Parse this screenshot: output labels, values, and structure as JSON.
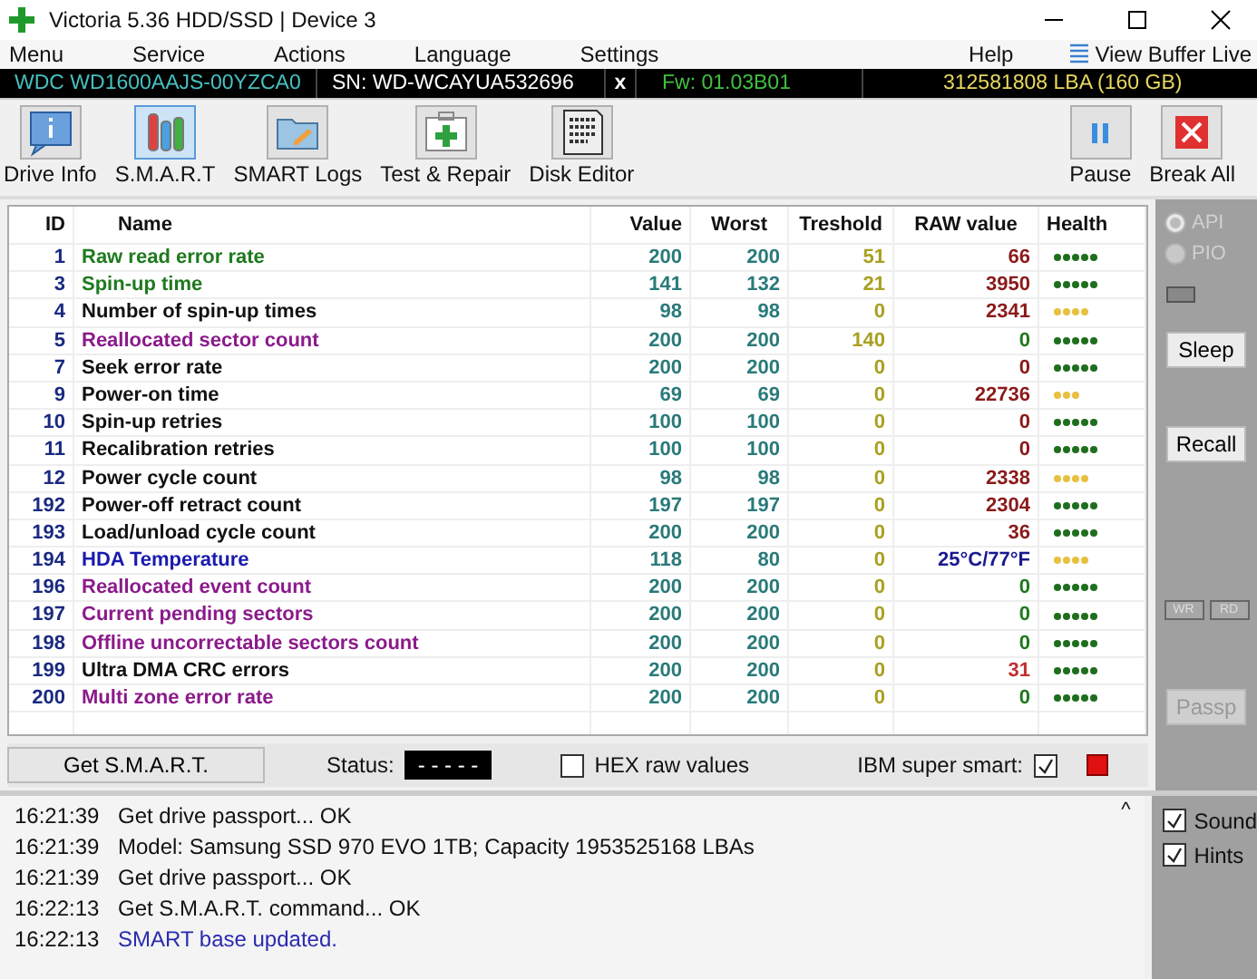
{
  "window": {
    "title": "Victoria 5.36 HDD/SSD | Device 3"
  },
  "menu": [
    "Menu",
    "Service",
    "Actions",
    "Language",
    "Settings",
    "Help"
  ],
  "view_buffer": "View Buffer Live",
  "drive_bar": {
    "model": "WDC WD1600AAJS-00YZCA0",
    "serial": "SN: WD-WCAYUA532696",
    "close": "x",
    "firmware": "Fw: 01.03B01",
    "capacity": "312581808 LBA (160 GB)"
  },
  "toolbar": [
    {
      "label": "Drive Info",
      "kind": "info",
      "selected": false
    },
    {
      "label": "S.M.A.R.T",
      "kind": "smart",
      "selected": true
    },
    {
      "label": "SMART Logs",
      "kind": "logs",
      "selected": false
    },
    {
      "label": "Test & Repair",
      "kind": "repair",
      "selected": false
    },
    {
      "label": "Disk Editor",
      "kind": "editor",
      "selected": false
    }
  ],
  "toolbar_right": [
    {
      "label": "Pause",
      "kind": "pause"
    },
    {
      "label": "Break All",
      "kind": "break"
    }
  ],
  "table": {
    "columns": [
      "ID",
      "Name",
      "Value",
      "Worst",
      "Treshold",
      "RAW value",
      "Health"
    ],
    "rows": [
      {
        "id": "1",
        "name": "Raw read error rate",
        "value": "200",
        "worst": "200",
        "treshold": "51",
        "raw": {
          "text": "66",
          "kind": "count"
        },
        "stars": 5,
        "color": "#1e7a1e"
      },
      {
        "id": "3",
        "name": "Spin-up time",
        "value": "141",
        "worst": "132",
        "treshold": "21",
        "raw": {
          "text": "3950",
          "kind": "count"
        },
        "stars": 5,
        "color": "#1e7a1e"
      },
      {
        "id": "4",
        "name": "Number of spin-up times",
        "value": "98",
        "worst": "98",
        "treshold": "0",
        "raw": {
          "text": "2341",
          "kind": "count"
        },
        "stars": 4,
        "color": "#111111"
      },
      {
        "id": "5",
        "name": "Reallocated sector count",
        "value": "200",
        "worst": "200",
        "treshold": "140",
        "raw": {
          "text": "0",
          "kind": "good"
        },
        "stars": 5,
        "color": "#8b1a8b"
      },
      {
        "id": "7",
        "name": "Seek error rate",
        "value": "200",
        "worst": "200",
        "treshold": "0",
        "raw": {
          "text": "0",
          "kind": "count"
        },
        "stars": 5,
        "color": "#111111"
      },
      {
        "id": "9",
        "name": "Power-on time",
        "value": "69",
        "worst": "69",
        "treshold": "0",
        "raw": {
          "text": "22736",
          "kind": "count"
        },
        "stars": 3,
        "color": "#111111"
      },
      {
        "id": "10",
        "name": "Spin-up retries",
        "value": "100",
        "worst": "100",
        "treshold": "0",
        "raw": {
          "text": "0",
          "kind": "count"
        },
        "stars": 5,
        "color": "#111111"
      },
      {
        "id": "11",
        "name": "Recalibration retries",
        "value": "100",
        "worst": "100",
        "treshold": "0",
        "raw": {
          "text": "0",
          "kind": "count"
        },
        "stars": 5,
        "color": "#111111"
      },
      {
        "id": "12",
        "name": "Power cycle count",
        "value": "98",
        "worst": "98",
        "treshold": "0",
        "raw": {
          "text": "2338",
          "kind": "count"
        },
        "stars": 4,
        "color": "#111111"
      },
      {
        "id": "192",
        "name": "Power-off retract count",
        "value": "197",
        "worst": "197",
        "treshold": "0",
        "raw": {
          "text": "2304",
          "kind": "count"
        },
        "stars": 5,
        "color": "#111111"
      },
      {
        "id": "193",
        "name": "Load/unload cycle count",
        "value": "200",
        "worst": "200",
        "treshold": "0",
        "raw": {
          "text": "36",
          "kind": "count"
        },
        "stars": 5,
        "color": "#111111"
      },
      {
        "id": "194",
        "name": "HDA Temperature",
        "value": "118",
        "worst": "80",
        "treshold": "0",
        "raw": {
          "text": "25°C/77°F",
          "kind": "temperature"
        },
        "stars": 4,
        "color": "#1a1ab0"
      },
      {
        "id": "196",
        "name": "Reallocated event count",
        "value": "200",
        "worst": "200",
        "treshold": "0",
        "raw": {
          "text": "0",
          "kind": "good"
        },
        "stars": 5,
        "color": "#8b1a8b"
      },
      {
        "id": "197",
        "name": "Current pending sectors",
        "value": "200",
        "worst": "200",
        "treshold": "0",
        "raw": {
          "text": "0",
          "kind": "good"
        },
        "stars": 5,
        "color": "#8b1a8b"
      },
      {
        "id": "198",
        "name": "Offline uncorrectable sectors count",
        "value": "200",
        "worst": "200",
        "treshold": "0",
        "raw": {
          "text": "0",
          "kind": "good"
        },
        "stars": 5,
        "color": "#8b1a8b"
      },
      {
        "id": "199",
        "name": "Ultra DMA CRC errors",
        "value": "200",
        "worst": "200",
        "treshold": "0",
        "raw": {
          "text": "31",
          "kind": "error"
        },
        "stars": 5,
        "color": "#111111"
      },
      {
        "id": "200",
        "name": "Multi zone error rate",
        "value": "200",
        "worst": "200",
        "treshold": "0",
        "raw": {
          "text": "0",
          "kind": "good"
        },
        "stars": 5,
        "color": "#8b1a8b"
      }
    ]
  },
  "side_panel": {
    "radios": [
      {
        "label": "API",
        "selected": true,
        "disabled": true
      },
      {
        "label": "PIO",
        "selected": false,
        "disabled": true
      }
    ],
    "buttons": [
      {
        "label": "Sleep",
        "disabled": false
      },
      {
        "label": "Recall",
        "disabled": false
      }
    ],
    "small_buttons": [
      {
        "label": "WR",
        "disabled": true
      },
      {
        "label": "RD",
        "disabled": true
      }
    ],
    "passp": {
      "label": "Passp",
      "disabled": true
    }
  },
  "bottom_bar": {
    "get_smart": "Get S.M.A.R.T.",
    "status_label": "Status:",
    "status_value": "- - - - -",
    "hex": {
      "label": "HEX raw values",
      "checked": false
    },
    "ibm": {
      "label": "IBM super smart:",
      "checked": true
    },
    "indicator": {
      "active": true
    }
  },
  "log": [
    {
      "time": "16:21:39",
      "message": "Get drive passport... OK",
      "highlight": false
    },
    {
      "time": "16:21:39",
      "message": "Model: Samsung SSD 970 EVO 1TB; Capacity 1953525168 LBAs",
      "highlight": false
    },
    {
      "time": "16:21:39",
      "message": "Get drive passport... OK",
      "highlight": false
    },
    {
      "time": "16:22:13",
      "message": "Get S.M.A.R.T. command... OK",
      "highlight": false
    },
    {
      "time": "16:22:13",
      "message": "SMART base updated.",
      "highlight": true
    }
  ],
  "log_scroll": "^",
  "options": [
    {
      "label": "Sound",
      "checked": true
    },
    {
      "label": "Hints",
      "checked": true
    }
  ]
}
